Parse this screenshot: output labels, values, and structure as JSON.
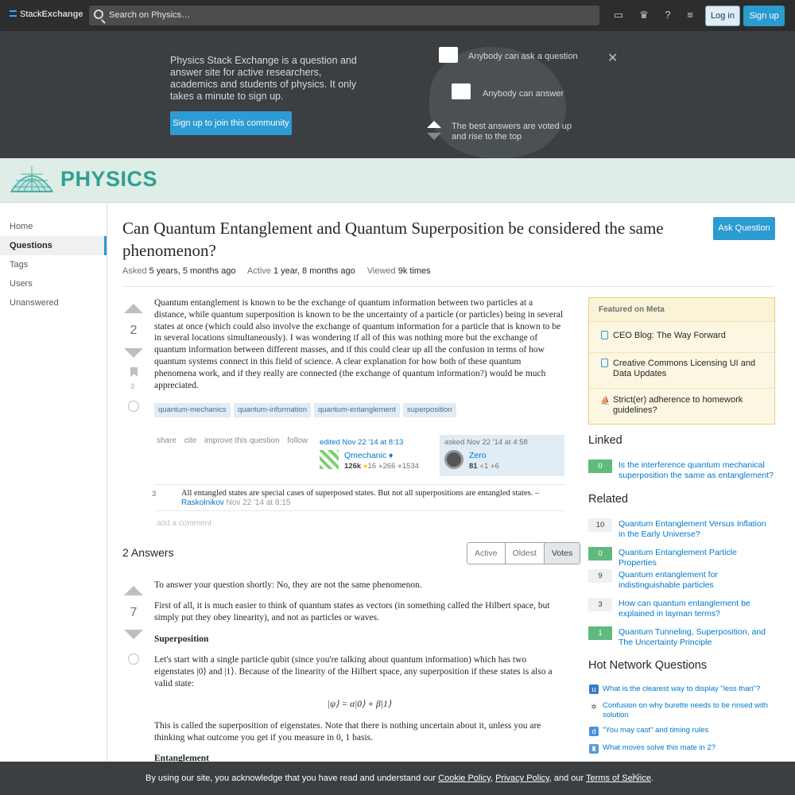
{
  "topbar": {
    "logo_a": "Stack",
    "logo_b": "Exchange",
    "search_placeholder": "Search on Physics…",
    "login": "Log in",
    "signup": "Sign up"
  },
  "hero": {
    "text": "Physics Stack Exchange is a question and answer site for active researchers, academics and students of physics. It only takes a minute to sign up.",
    "button": "Sign up to join this community",
    "item1": "Anybody can ask a question",
    "item2": "Anybody can answer",
    "item3": "The best answers are voted up and rise to the top"
  },
  "banner": {
    "title": "PHYSICS"
  },
  "nav": {
    "home": "Home",
    "questions": "Questions",
    "tags": "Tags",
    "users": "Users",
    "unanswered": "Unanswered"
  },
  "question": {
    "title": "Can Quantum Entanglement and Quantum Superposition be considered the same phenomenon?",
    "ask_button": "Ask Question",
    "asked_label": "Asked",
    "asked_value": "5 years, 5 months ago",
    "active_label": "Active",
    "active_value": "1 year, 8 months ago",
    "viewed_label": "Viewed",
    "viewed_value": "9k times",
    "votes": "2",
    "favorites": "3",
    "body": "Quantum entanglement is known to be the exchange of quantum information between two particles at a distance, while quantum superposition is known to be the uncertainty of a particle (or particles) being in several states at once (which could also involve the exchange of quantum information for a particle that is known to be in several locations simultaneously). I was wondering if all of this was nothing more but the exchange of quantum information between different masses, and if this could clear up all the confusion in terms of how quantum systems connect in this field of science. A clear explanation for how both of these quantum phenomena work, and if they really are connected (the exchange of quantum information?) would be much appreciated.",
    "tags": [
      "quantum-mechanics",
      "quantum-information",
      "quantum-entanglement",
      "superposition"
    ],
    "menu": [
      "share",
      "cite",
      "improve this question",
      "follow"
    ],
    "edited": "edited Nov 22 '14 at 8:13",
    "editor": "Qmechanic ♦",
    "editor_rep": "126k",
    "editor_gold": "16",
    "editor_silver": "266",
    "editor_bronze": "1534",
    "asked_sig": "asked Nov 22 '14 at 4:58",
    "asker": "Zero",
    "asker_rep": "81",
    "asker_silver": "1",
    "asker_bronze": "6"
  },
  "comment": {
    "score": "3",
    "text": "All entangled states are special cases of superposed states. But not all superpositions are entangled states. –",
    "user": "Raskolnikov",
    "time": "Nov 22 '14 at 8:15",
    "add": "add a comment"
  },
  "answers": {
    "heading": "2 Answers",
    "tabs": [
      "Active",
      "Oldest",
      "Votes"
    ],
    "votes": "7",
    "p1": "To answer your question shortly: No, they are not the same phenomenon.",
    "p2": "First of all, it is much easier to think of quantum states as vectors (in something called the Hilbert space, but simply put they obey linearity), and not as particles or waves.",
    "h1": "Superposition",
    "p3": "Let's start with a single particle qubit (since you're talking about quantum information) which has two eigenstates |0⟩ and |1⟩. Because of the linearity of the Hilbert space, any superposition if these states is also a valid state:",
    "eq": "|ψ⟩ = α|0⟩ + β|1⟩",
    "p4": "This is called the superposition of eigenstates. Note that there is nothing uncertain about it, unless you are thinking what outcome you get if you measure in 0, 1 basis.",
    "h2": "Entanglement"
  },
  "sidebar": {
    "meta_title": "Featured on Meta",
    "meta": [
      "CEO Blog: The Way Forward",
      "Creative Commons Licensing UI and Data Updates",
      "Strict(er) adherence to homework guidelines?"
    ],
    "linked_title": "Linked",
    "linked": [
      {
        "score": "0",
        "text": "Is the interference quantum mechanical superposition the same as entanglement?"
      }
    ],
    "related_title": "Related",
    "related": [
      {
        "score": "10",
        "text": "Quantum Entanglement Versus Inflation in the Early Universe?"
      },
      {
        "score": "0",
        "text": "Quantum Entanglement Particle Properties"
      },
      {
        "score": "9",
        "text": "Quantum entanglement for indistinguishable particles"
      },
      {
        "score": "3",
        "text": "How can quantum entanglement be explained in layman terms?"
      },
      {
        "score": "1",
        "text": "Quantum Tunneling, Superposition, and The Uncertainty Principle"
      }
    ],
    "hnq_title": "Hot Network Questions",
    "hnq": [
      "What is the clearest way to display \"less than\"?",
      "Confusion on why burette needs to be rinsed with solution",
      "\"You may cast\" and timing rules",
      "What moves solve this mate in 2?"
    ]
  },
  "cookie": {
    "pre": "By using our site, you acknowledge that you have read and understand our ",
    "l1": "Cookie Policy",
    ",": ", ",
    "l2": "Privacy Policy",
    "mid": ", and our ",
    "l3": "Terms of Service",
    "end": "."
  }
}
